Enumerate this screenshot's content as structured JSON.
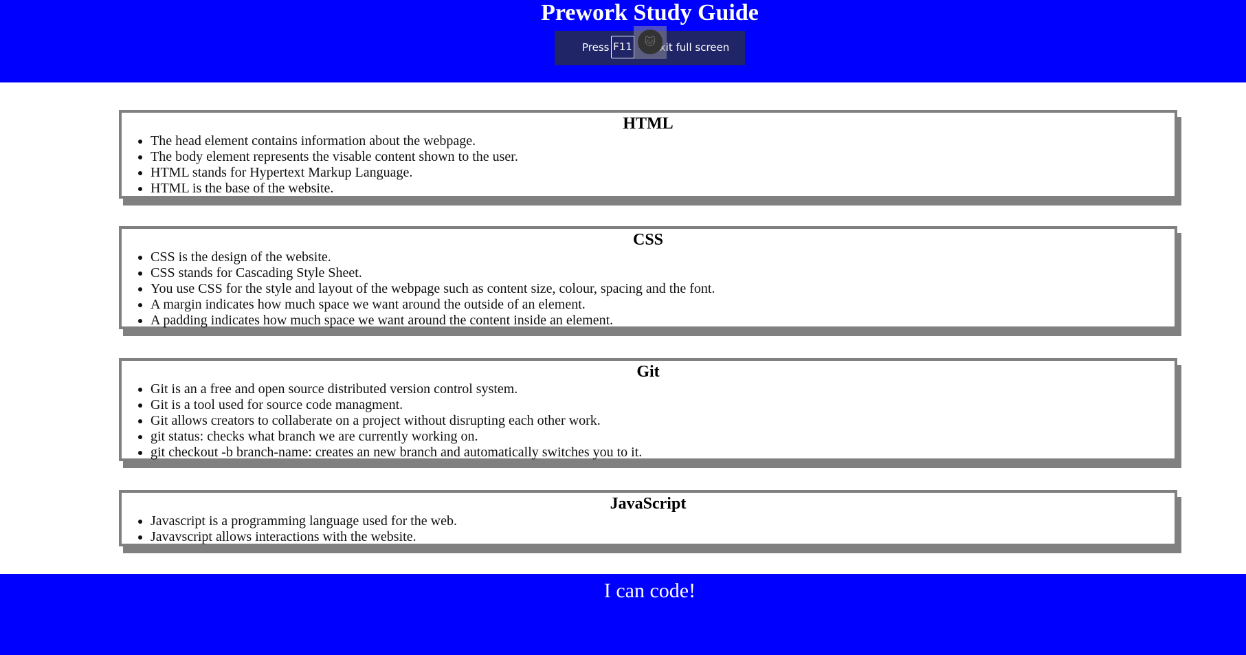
{
  "header": {
    "title": "Prework Study Guide",
    "brand_color": "#0000ff"
  },
  "fullscreen_notice": {
    "press": "Press",
    "key": "F11",
    "rest": "to exit full screen"
  },
  "sections": [
    {
      "title": "HTML",
      "items": [
        "The head element contains information about the webpage.",
        "The body element represents the visable content shown to the user.",
        "HTML stands for Hypertext Markup Language.",
        "HTML is the base of the website."
      ]
    },
    {
      "title": "CSS",
      "items": [
        "CSS is the design of the website.",
        "CSS stands for Cascading Style Sheet.",
        "You use CSS for the style and layout of the webpage such as content size, colour, spacing and the font.",
        "A margin indicates how much space we want around the outside of an element.",
        "A padding indicates how much space we want around the content inside an element."
      ]
    },
    {
      "title": "Git",
      "items": [
        "Git is an a free and open source distributed version control system.",
        "Git is a tool used for source code managment.",
        "Git allows creators to collaberate on a project without disrupting each other work.",
        "git status: checks what branch we are currently working on.",
        "git checkout -b branch-name: creates an new branch and automatically switches you to it."
      ]
    },
    {
      "title": "JavaScript",
      "items": [
        "Javascript is a programming language used for the web.",
        "Javavscript allows interactions with the website."
      ]
    }
  ],
  "footer": {
    "text": "I can code!"
  },
  "icons": {
    "avatar": "cat-avatar-icon"
  }
}
